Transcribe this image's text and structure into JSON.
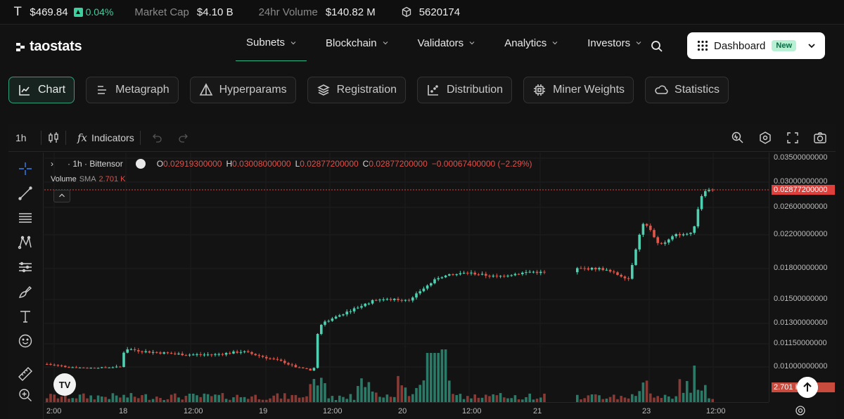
{
  "ticker": {
    "symbol": "T",
    "price": "$469.84",
    "change": "0.04%",
    "market_cap_label": "Market Cap",
    "market_cap": "$4.10 B",
    "volume_label": "24hr Volume",
    "volume": "$140.82 M",
    "block_number": "5620174",
    "up_color": "#3ecf9e"
  },
  "header": {
    "logo": "taostats",
    "nav": [
      "Subnets",
      "Blockchain",
      "Validators",
      "Analytics",
      "Investors"
    ],
    "active_nav": "Subnets",
    "dashboard_label": "Dashboard",
    "dashboard_badge": "New"
  },
  "tabs": [
    {
      "label": "Chart",
      "icon": "chart-icon",
      "active": true
    },
    {
      "label": "Metagraph",
      "icon": "lines-icon",
      "active": false
    },
    {
      "label": "Hyperparams",
      "icon": "prism-icon",
      "active": false
    },
    {
      "label": "Registration",
      "icon": "layers-icon",
      "active": false
    },
    {
      "label": "Distribution",
      "icon": "scatter-icon",
      "active": false
    },
    {
      "label": "Miner Weights",
      "icon": "chip-icon",
      "active": false
    },
    {
      "label": "Statistics",
      "icon": "cloud-icon",
      "active": false
    }
  ],
  "toolbar": {
    "interval": "1h",
    "indicators_label": "Indicators",
    "fx": "fx"
  },
  "legend": {
    "collapse_symbol": "›",
    "title": "· 1h · Bittensor",
    "o_label": "O",
    "o": "0.02919300000",
    "h_label": "H",
    "h": "0.03008000000",
    "l_label": "L",
    "l": "0.02877200000",
    "c_label": "C",
    "c": "0.02877200000",
    "change": "−0.00067400000 (−2.29%)",
    "volume_label": "Volume",
    "sma_label": "SMA",
    "volume_value": "2.701 K"
  },
  "tv_logo": "TV",
  "colors": {
    "up": "#4fd1b1",
    "down": "#e0564a",
    "up_vol": "#2b7a68",
    "down_vol": "#8a3a34",
    "accent": "#2fb68a"
  },
  "chart_data": {
    "type": "candlestick",
    "title": "1h · Bittensor",
    "price_axis_ticks": [
      "0.03500000000",
      "0.03000000000",
      "0.02600000000",
      "0.02200000000",
      "0.01800000000",
      "0.01500000000",
      "0.01300000000",
      "0.01150000000",
      "0.01000000000"
    ],
    "last_price_label": "0.02877200000",
    "volume_label": "2.701 K",
    "time_axis_ticks": [
      "2:00",
      "18",
      "12:00",
      "19",
      "12:00",
      "20",
      "12:00",
      "21",
      "23",
      "12:00"
    ],
    "last_close": 0.028772,
    "series": [
      {
        "name": "Bittensor",
        "points_approx": [
          {
            "t": "17 02:00",
            "c": 0.0102
          },
          {
            "t": "17 12:00",
            "c": 0.0099
          },
          {
            "t": "18 00:00",
            "c": 0.0111
          },
          {
            "t": "18 12:00",
            "c": 0.0108
          },
          {
            "t": "19 00:00",
            "c": 0.0103
          },
          {
            "t": "19 06:00",
            "c": 0.0095
          },
          {
            "t": "19 08:00",
            "c": 0.0132
          },
          {
            "t": "19 20:00",
            "c": 0.015
          },
          {
            "t": "20 00:00",
            "c": 0.015
          },
          {
            "t": "20 12:00",
            "c": 0.0172
          },
          {
            "t": "20 20:00",
            "c": 0.0177
          },
          {
            "t": "21 12:00",
            "c": 0.0179
          },
          {
            "t": "22 12:00",
            "c": 0.019
          },
          {
            "t": "22 18:00",
            "c": 0.0237
          },
          {
            "t": "23 00:00",
            "c": 0.021
          },
          {
            "t": "23 06:00",
            "c": 0.0225
          },
          {
            "t": "23 10:00",
            "c": 0.0298
          },
          {
            "t": "23 12:00",
            "c": 0.028772
          }
        ]
      }
    ]
  }
}
